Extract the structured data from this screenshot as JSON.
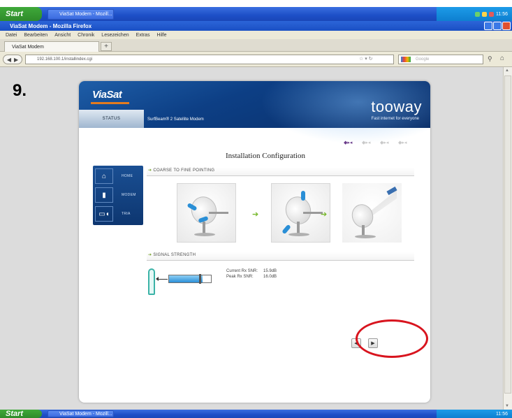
{
  "os": {
    "start_label": "Start",
    "task_label": "ViaSat Modem - Mozill...",
    "tray_time": "11:56",
    "bottom_task_label": "ViaSat Modem - Mozill..."
  },
  "browser": {
    "window_title": "ViaSat Modem - Mozilla Firefox",
    "menu": [
      "Datei",
      "Bearbeiten",
      "Ansicht",
      "Chronik",
      "Lesezeichen",
      "Extras",
      "Hilfe"
    ],
    "tab_label": "ViaSat Modem",
    "url": "192.168.100.1/installindex.cgi",
    "search_placeholder": "Google"
  },
  "step_label": "9.",
  "device": {
    "brand": "ViaSat",
    "product_logo": "tooway",
    "tagline": "Fast internet for everyone",
    "status_tab": "STATUS",
    "model_name": "SurfBeam® 2 Satellite Modem",
    "page_title": "Installation Configuration",
    "nav": [
      {
        "icon": "home-icon",
        "label": "HOME"
      },
      {
        "icon": "modem-icon",
        "label": "MODEM"
      },
      {
        "icon": "tria-icon",
        "label": "TRIA"
      }
    ],
    "section_pointing": "COARSE TO FINE POINTING",
    "section_signal": "SIGNAL STRENGTH",
    "signal": {
      "current_label": "Current Rx SNR:",
      "current_value": "15.9dB",
      "peak_label": "Peak Rx SNR:",
      "peak_value": "16.0dB",
      "level": 0.8
    }
  },
  "colors": {
    "banner": "#0d3f85",
    "accent_green": "#76b82a",
    "highlight_red": "#d8141e"
  }
}
